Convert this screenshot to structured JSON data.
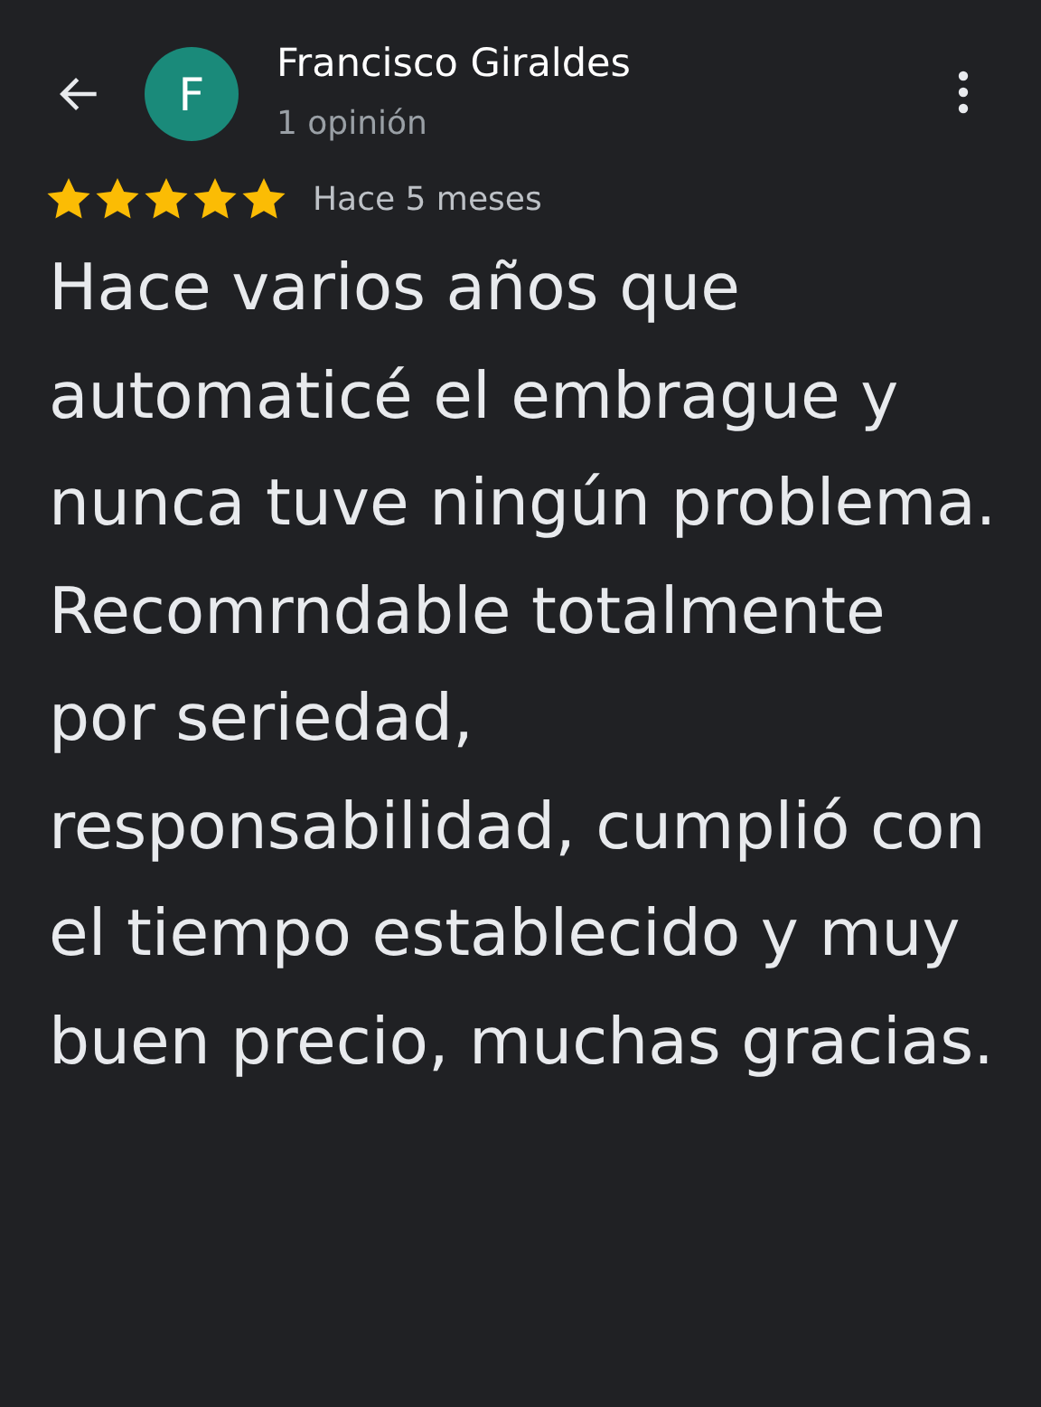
{
  "reviewer": {
    "avatar_letter": "F",
    "name": "Francisco Giraldes",
    "review_count": "1 opinión"
  },
  "review": {
    "stars": 5,
    "time": "Hace 5 meses",
    "text": "Hace varios años que automaticé el embrague y nunca tuve ningún problema. Recomrndable totalmente por seriedad, responsabilidad, cumplió con el tiempo establecido y muy buen precio, muchas gracias."
  }
}
